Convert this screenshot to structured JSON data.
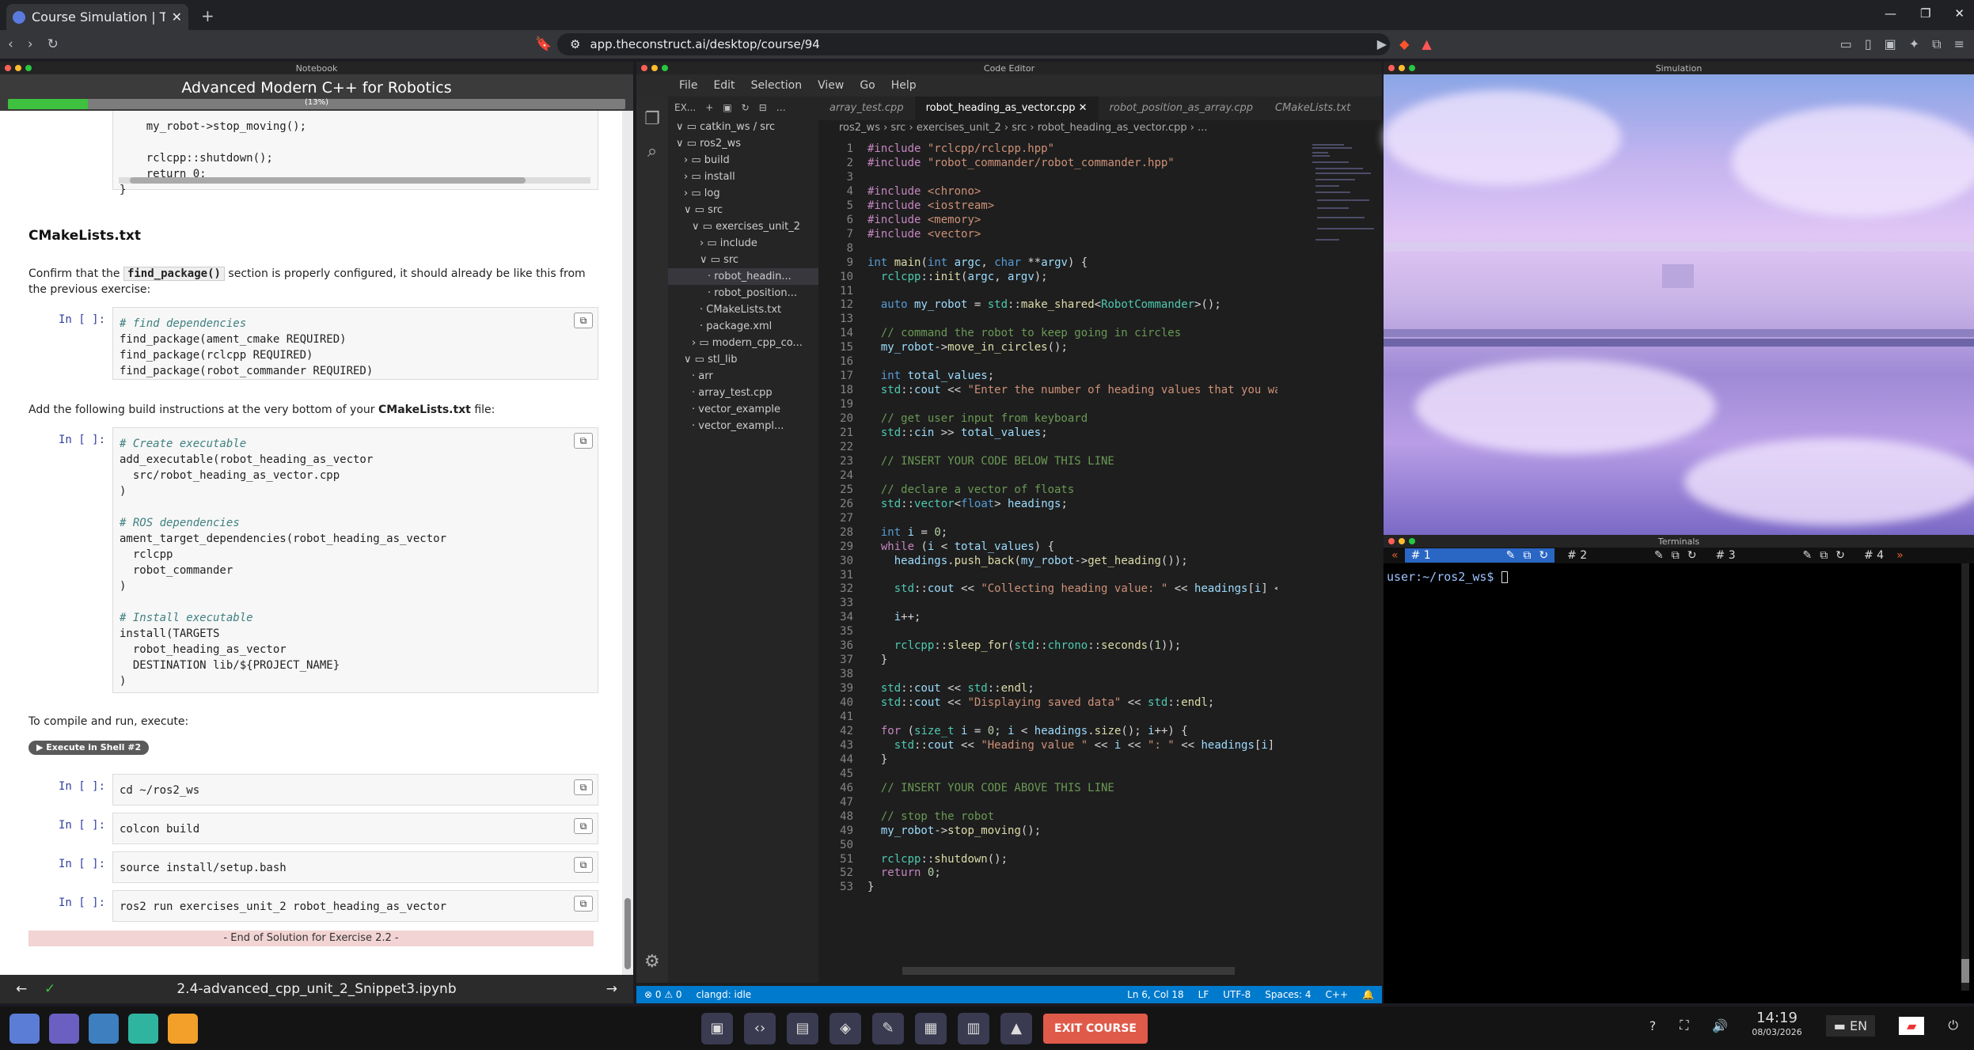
{
  "browser": {
    "tab_title": "Course Simulation | The",
    "url": "app.theconstruct.ai/desktop/course/94"
  },
  "notebook": {
    "window_title": "Notebook",
    "course_title": "Advanced Modern C++ for Robotics",
    "progress_label": "(13%)",
    "progress": 0.13,
    "prev_code": [
      "    my_robot->stop_moving();",
      "",
      "    rclcpp::shutdown();",
      "    return 0;",
      "}"
    ],
    "heading": "CMakeLists.txt",
    "para1": "Confirm that the",
    "para1_code": "find_package()",
    "para1_rest": "section is properly configured, it should already be like this from the previous exercise:",
    "in_label": "In [ ]:",
    "cell1": [
      "# find dependencies",
      "find_package(ament_cmake REQUIRED)",
      "find_package(rclcpp REQUIRED)",
      "find_package(robot_commander REQUIRED)"
    ],
    "para2": "Add the following build instructions at the very bottom of your",
    "para2_bold": "CMakeLists.txt",
    "para2_rest": "file:",
    "cell2": [
      "# Create executable",
      "add_executable(robot_heading_as_vector",
      "  src/robot_heading_as_vector.cpp",
      ")",
      "",
      "# ROS dependencies",
      "ament_target_dependencies(robot_heading_as_vector",
      "  rclcpp",
      "  robot_commander",
      ")",
      "",
      "# Install executable",
      "install(TARGETS",
      "  robot_heading_as_vector",
      "  DESTINATION lib/${PROJECT_NAME}",
      ")"
    ],
    "para3": "To compile and run, execute:",
    "shell_button": "▶ Execute in Shell #2",
    "cmd1": "cd ~/ros2_ws",
    "cmd2": "colcon build",
    "cmd3": "source install/setup.bash",
    "cmd4": "ros2 run exercises_unit_2 robot_heading_as_vector",
    "end_banner": "- End of Solution for Exercise 2.2 -",
    "footer_file": "2.4-advanced_cpp_unit_2_Snippet3.ipynb"
  },
  "editor": {
    "window_title": "Code Editor",
    "menu": [
      "File",
      "Edit",
      "Selection",
      "View",
      "Go",
      "Help"
    ],
    "explorer_label": "EX...",
    "tree": [
      "catkin_ws / src",
      "ros2_ws",
      "build",
      "install",
      "log",
      "src",
      "exercises_unit_2",
      "include",
      "src",
      "robot_headin...",
      "robot_position...",
      "CMakeLists.txt",
      "package.xml",
      "modern_cpp_co...",
      "stl_lib",
      "arr",
      "array_test.cpp",
      "vector_example",
      "vector_exampl..."
    ],
    "tabs": [
      "array_test.cpp",
      "robot_heading_as_vector.cpp",
      "robot_position_as_array.cpp",
      "CMakeLists.txt"
    ],
    "breadcrumb": [
      "ros2_ws",
      "src",
      "exercises_unit_2",
      "src",
      "robot_heading_as_vector.cpp",
      "..."
    ],
    "status_left": "⊗ 0 ⚠ 0",
    "status_clangd": "clangd: idle",
    "status_pos": "Ln 6, Col 18",
    "status_eol": "LF",
    "status_enc": "UTF-8",
    "status_spaces": "Spaces: 4",
    "status_lang": "C++"
  },
  "simulation": {
    "window_title": "Simulation"
  },
  "terminal": {
    "window_title": "Terminals",
    "tabs": [
      "# 1",
      "# 2",
      "# 3",
      "# 4"
    ],
    "prompt": "user:~/ros2_ws$"
  },
  "taskbar": {
    "exit_label": "EXIT COURSE",
    "lang": "EN",
    "time": "14:19",
    "date": "08/03/2026"
  }
}
